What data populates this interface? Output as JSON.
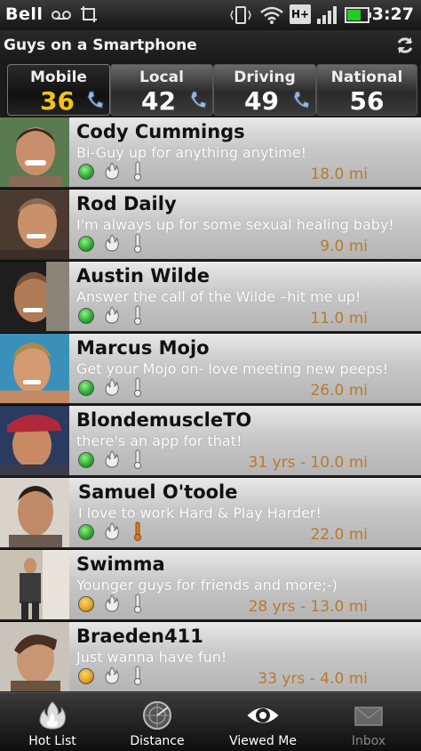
{
  "status_bar": {
    "carrier": "Bell",
    "time": "3:27",
    "network_badge": "H+",
    "icons": [
      "voicemail-icon",
      "screenshot-icon",
      "vibrate-icon",
      "wifi-icon",
      "signal-icon",
      "battery-icon"
    ]
  },
  "app": {
    "title": "Guys on a Smartphone",
    "refresh_icon": "refresh-icon"
  },
  "tabs": [
    {
      "label": "Mobile",
      "count": "36",
      "active": true
    },
    {
      "label": "Local",
      "count": "42",
      "active": false
    },
    {
      "label": "Driving",
      "count": "49",
      "active": false
    },
    {
      "label": "National",
      "count": "56",
      "active": false
    }
  ],
  "profiles": [
    {
      "name": "Cody Cummings",
      "tagline": "Bi-Guy up for anything anytime!",
      "distance": "18.0 mi",
      "status": "green",
      "thermo": "gray"
    },
    {
      "name": "Rod Daily",
      "tagline": "I'm always up for some sexual healing baby!",
      "distance": "9.0 mi",
      "status": "green",
      "thermo": "gray"
    },
    {
      "name": "Austin Wilde",
      "tagline": "Answer the call of the Wilde –hit me up!",
      "distance": "11.0 mi",
      "status": "green",
      "thermo": "gray"
    },
    {
      "name": "Marcus Mojo",
      "tagline": "Get your Mojo on- love meeting new peeps!",
      "distance": "26.0 mi",
      "status": "green",
      "thermo": "gray"
    },
    {
      "name": "BlondemuscleTO",
      "tagline": "there's an app for that!",
      "distance": "31 yrs - 10.0 mi",
      "status": "green",
      "thermo": "gray"
    },
    {
      "name": "Samuel O'toole",
      "tagline": "I love to work Hard & Play Harder!",
      "distance": "22.0 mi",
      "status": "green",
      "thermo": "orange"
    },
    {
      "name": "Swimma",
      "tagline": "Younger guys for friends and more;-)",
      "distance": "28 yrs - 13.0 mi",
      "status": "orange",
      "thermo": "gray"
    },
    {
      "name": "Braeden411",
      "tagline": "Just wanna have fun!",
      "distance": "33 yrs - 4.0 mi",
      "status": "orange",
      "thermo": "gray"
    }
  ],
  "bottom_nav": [
    {
      "label": "Hot List",
      "icon": "flame-icon",
      "enabled": true
    },
    {
      "label": "Distance",
      "icon": "radar-icon",
      "enabled": true
    },
    {
      "label": "Viewed Me",
      "icon": "eye-icon",
      "enabled": true
    },
    {
      "label": "Inbox",
      "icon": "envelope-icon",
      "enabled": false
    }
  ],
  "colors": {
    "active_count": "#f2c21a",
    "distance_text": "#b87a2a",
    "status_green": "#2aa82a",
    "status_orange": "#e0a020",
    "thermo_orange": "#e07818"
  }
}
